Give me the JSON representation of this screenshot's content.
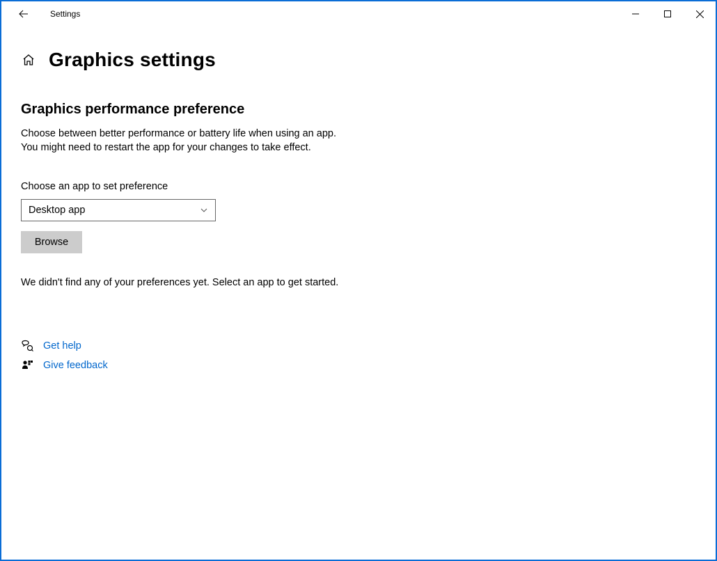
{
  "window": {
    "app_title": "Settings"
  },
  "page": {
    "title": "Graphics settings",
    "section_heading": "Graphics performance preference",
    "body_line1": "Choose between better performance or battery life when using an app.",
    "body_line2": "You might need to restart the app for your changes to take effect.",
    "field_label": "Choose an app to set preference",
    "dropdown_selected": "Desktop app",
    "browse_label": "Browse",
    "empty_state": "We didn't find any of your preferences yet. Select an app to get started."
  },
  "links": {
    "get_help": "Get help",
    "give_feedback": "Give feedback"
  }
}
